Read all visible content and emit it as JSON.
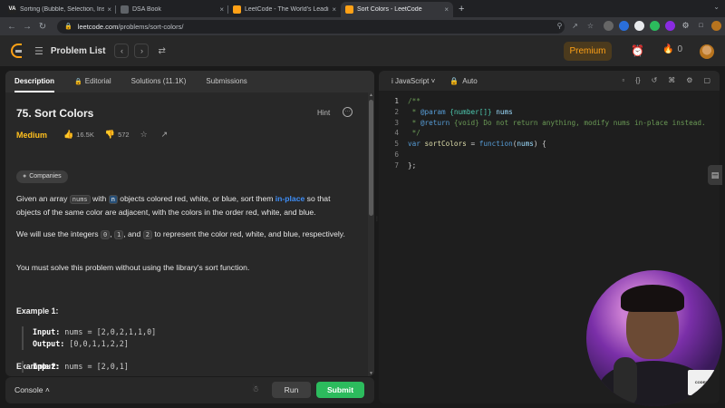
{
  "browser": {
    "tabs": [
      {
        "title": "Sorting (Bubble, Selection, Inser",
        "favicon": "VA",
        "favicon_color": "#222222",
        "active": false
      },
      {
        "title": "DSA Book",
        "favicon": "",
        "favicon_color": "#5f6368",
        "active": false
      },
      {
        "title": "LeetCode - The World's Leading",
        "favicon": "",
        "favicon_color": "#ffa116",
        "active": false
      },
      {
        "title": "Sort Colors - LeetCode",
        "favicon": "",
        "favicon_color": "#ffa116",
        "active": true
      }
    ],
    "tab_close_glyph": "×",
    "new_tab_glyph": "+",
    "url_host": "leetcode.com",
    "url_path": "/problems/sort-colors/"
  },
  "lcnav": {
    "problem_list_label": "Problem List",
    "premium_label": "Premium",
    "streak_count": "0"
  },
  "problem": {
    "tabs": [
      "Description",
      "Editorial",
      "Solutions (11.1K)",
      "Submissions"
    ],
    "title": "75. Sort Colors",
    "hint_label": "Hint",
    "difficulty": "Medium",
    "likes": "16.5K",
    "dislikes": "572",
    "companies_label": "Companies",
    "p1_a": "Given an array ",
    "p1_nums": "nums",
    "p1_b": " with ",
    "p1_n": "n",
    "p1_c": " objects colored red, white, or blue, sort them ",
    "p1_link": "in-place",
    "p1_d": " so that objects of the same color are adjacent, with the colors in the order red, white, and blue.",
    "p2_a": "We will use the integers ",
    "p2_0": "0",
    "p2_b": ", ",
    "p2_1": "1",
    "p2_c": ", and ",
    "p2_2": "2",
    "p2_d": " to represent the color red, white, and blue, respectively.",
    "p3": "You must solve this problem without using the library's sort function.",
    "example1_title": "Example 1:",
    "example1_input_label": "Input:",
    "example1_input": " nums = [2,0,2,1,1,0]",
    "example1_output_label": "Output:",
    "example1_output": " [0,0,1,1,2,2]",
    "example2_title": "Example 2:",
    "example2_input_label": "Input:",
    "example2_input": " nums = [2,0,1]"
  },
  "console": {
    "console_label": "Console",
    "run_label": "Run",
    "submit_label": "Submit"
  },
  "editor": {
    "language": "JavaScript",
    "auto_label": "Auto",
    "line_numbers": [
      "1",
      "2",
      "3",
      "4",
      "5",
      "6",
      "7"
    ],
    "lines": {
      "l1": "/**",
      "l2a": " * ",
      "l2b": "@param",
      "l2c": " {number[]} ",
      "l2d": "nums",
      "l3a": " * ",
      "l3b": "@return",
      "l3c": " {void} Do not return anything, modify nums in-place instead.",
      "l4": " */",
      "l5a": "var ",
      "l5b": "sortColors",
      "l5c": " = ",
      "l5d": "function",
      "l5e": "(",
      "l5f": "nums",
      "l5g": ") {",
      "l6": "",
      "l7": "};"
    }
  },
  "webcam": {
    "card_text": "CODER"
  },
  "icons": {
    "back": "back-arrow-icon",
    "forward": "forward-arrow-icon",
    "reload": "reload-icon",
    "lock": "lock-icon",
    "shuffle": "shuffle-icon",
    "alarm": "alarm-clock-icon",
    "streak": "fire-icon",
    "like": "thumbs-up-icon",
    "dislike": "thumbs-down-icon",
    "star": "star-icon",
    "share": "share-icon",
    "tag": "tag-icon",
    "bug": "bug-icon"
  },
  "colors": {
    "accent": "#ffa116",
    "medium": "#ffc01e",
    "submit": "#2cbb5d",
    "link": "#3e8ef7"
  }
}
